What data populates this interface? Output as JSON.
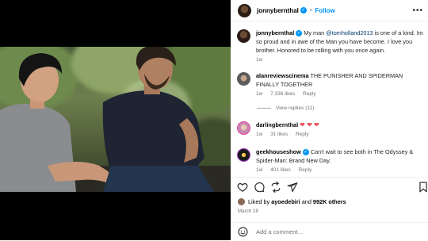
{
  "post": {
    "author": "jonnybernthal",
    "follow_label": "Follow",
    "separator": "•",
    "more_icon": "more-horizontal-icon"
  },
  "caption": {
    "author": "jonnybernthal",
    "text_before": "My man ",
    "mention": "@tomholland2013",
    "text_after": " is one of a kind. Im so proud and in awe of the Man you have become. I love you brother. Honored to be rolling with you once again.",
    "time": "1w"
  },
  "comments": [
    {
      "author": "alanreviewscinema",
      "text": "THE PUNISHER AND SPIDERMAN FINALLY TOGETHER",
      "time": "1w",
      "likes": "7,336 likes",
      "reply": "Reply",
      "view_replies": "View replies (11)"
    },
    {
      "author": "darlingbernthal",
      "text": "❤ ❤ ❤",
      "time": "1w",
      "likes": "31 likes",
      "reply": "Reply"
    },
    {
      "author": "geekhouseshow",
      "text": "Can't wait to see both in The Odyssey & Spider-Man: Brand New Day.",
      "time": "1w",
      "likes": "401 likes",
      "reply": "Reply"
    }
  ],
  "actions": {
    "icons": [
      "heart-icon",
      "comment-icon",
      "share-icon",
      "send-icon",
      "bookmark-icon"
    ]
  },
  "likes": {
    "prefix": "Liked by ",
    "user": "ayoedebiri",
    "middle": " and ",
    "count": "992K others"
  },
  "date": "March 18",
  "add_comment": {
    "placeholder": "Add a comment…"
  },
  "colors": {
    "accent": "#0095f6",
    "heart": "#ed4956",
    "muted": "#737373"
  }
}
